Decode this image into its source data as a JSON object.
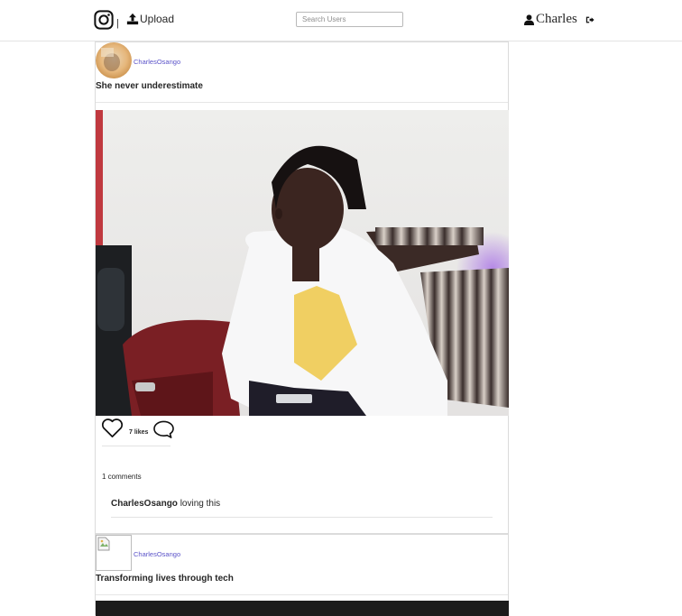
{
  "navbar": {
    "logo_icon": "instagram-icon",
    "separator": "|",
    "upload_icon": "upload-icon",
    "upload_label": "Upload",
    "search_placeholder": "Search Users",
    "user_icon": "user-icon",
    "username": "Charles",
    "logout_icon": "logout-icon"
  },
  "posts": [
    {
      "author": "CharlesOsango",
      "caption": "She never underestimate",
      "likes_label": "7 likes",
      "comments_count_label": "1 comments",
      "comments": [
        {
          "user": "CharlesOsango",
          "text": "loving this"
        }
      ]
    },
    {
      "author": "CharlesOsango",
      "caption": "Transforming lives through tech"
    }
  ],
  "colors": {
    "accent_link": "#5b53c9",
    "border": "#dbdbdb",
    "text": "#262626"
  }
}
